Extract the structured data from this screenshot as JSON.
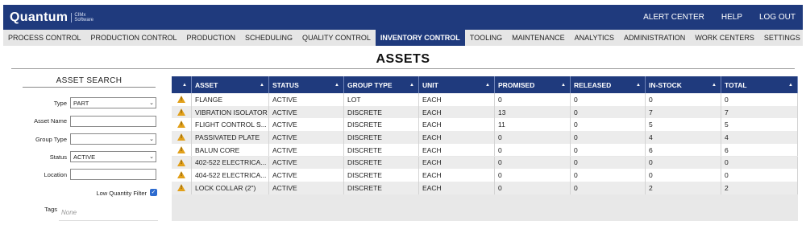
{
  "brand": {
    "name": "Quantum",
    "sub_line1": "CIMx",
    "sub_line2": "Software"
  },
  "top_links": [
    "ALERT CENTER",
    "HELP",
    "LOG OUT"
  ],
  "nav": {
    "items": [
      "PROCESS CONTROL",
      "PRODUCTION CONTROL",
      "PRODUCTION",
      "SCHEDULING",
      "QUALITY CONTROL",
      "INVENTORY CONTROL",
      "TOOLING",
      "MAINTENANCE",
      "ANALYTICS",
      "ADMINISTRATION",
      "WORK CENTERS",
      "SETTINGS"
    ],
    "active": "INVENTORY CONTROL"
  },
  "page_title": "ASSETS",
  "search": {
    "title": "ASSET SEARCH",
    "type_label": "Type",
    "type_value": "PART",
    "asset_name_label": "Asset Name",
    "asset_name_value": "",
    "group_type_label": "Group Type",
    "group_type_value": "",
    "status_label": "Status",
    "status_value": "ACTIVE",
    "location_label": "Location",
    "location_value": "",
    "low_qty_label": "Low Quantity Filter",
    "low_qty_checked": true,
    "tags_label": "Tags",
    "tags_placeholder": "None"
  },
  "table": {
    "columns": [
      "ASSET",
      "STATUS",
      "GROUP TYPE",
      "UNIT",
      "PROMISED",
      "RELEASED",
      "IN-STOCK",
      "TOTAL"
    ],
    "rows": [
      [
        "FLANGE",
        "ACTIVE",
        "LOT",
        "EACH",
        "0",
        "0",
        "0",
        "0"
      ],
      [
        "VIBRATION ISOLATOR",
        "ACTIVE",
        "DISCRETE",
        "EACH",
        "13",
        "0",
        "7",
        "7"
      ],
      [
        "FLIGHT CONTROL S...",
        "ACTIVE",
        "DISCRETE",
        "EACH",
        "11",
        "0",
        "5",
        "5"
      ],
      [
        "PASSIVATED PLATE",
        "ACTIVE",
        "DISCRETE",
        "EACH",
        "0",
        "0",
        "4",
        "4"
      ],
      [
        "BALUN CORE",
        "ACTIVE",
        "DISCRETE",
        "EACH",
        "0",
        "0",
        "6",
        "6"
      ],
      [
        "402-522 ELECTRICA...",
        "ACTIVE",
        "DISCRETE",
        "EACH",
        "0",
        "0",
        "0",
        "0"
      ],
      [
        "404-522 ELECTRICA...",
        "ACTIVE",
        "DISCRETE",
        "EACH",
        "0",
        "0",
        "0",
        "0"
      ],
      [
        "LOCK COLLAR (2\")",
        "ACTIVE",
        "DISCRETE",
        "EACH",
        "0",
        "0",
        "2",
        "2"
      ]
    ]
  },
  "colors": {
    "brand_blue": "#1f3a7d",
    "warning": "#e2a019",
    "checkbox": "#2d6bcf"
  }
}
